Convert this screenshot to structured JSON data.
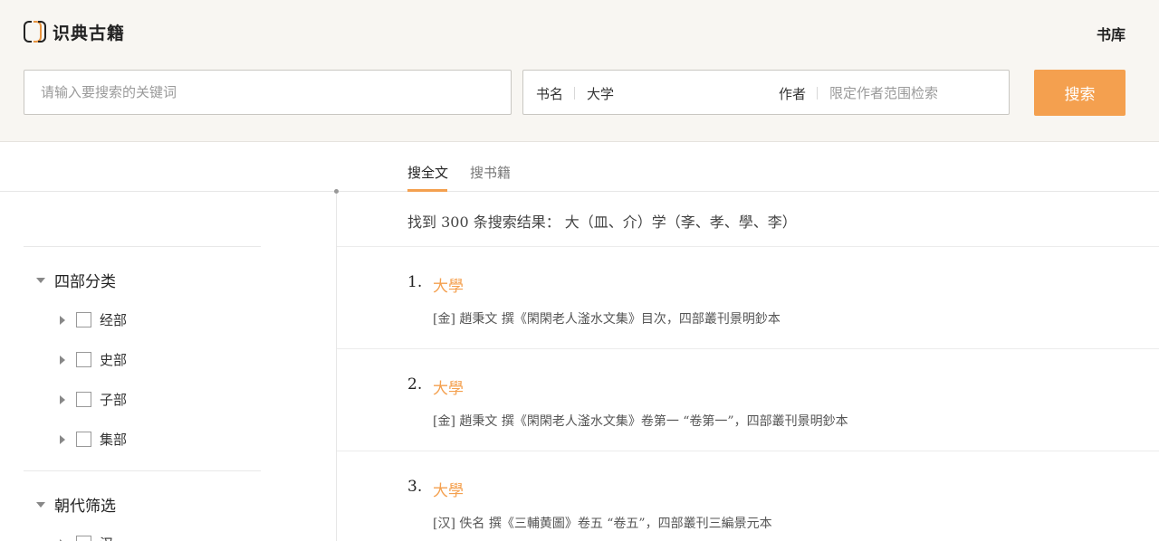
{
  "header": {
    "logo_text": "识典古籍",
    "library_link": "书库"
  },
  "search": {
    "keyword_placeholder": "请输入要搜索的关键词",
    "book_label": "书名",
    "book_value": "大学",
    "author_label": "作者",
    "author_placeholder": "限定作者范围检索",
    "button_label": "搜索"
  },
  "tabs": [
    {
      "label": "搜全文",
      "active": true
    },
    {
      "label": "搜书籍",
      "active": false
    }
  ],
  "sidebar": {
    "groups": [
      {
        "title": "四部分类",
        "items": [
          "经部",
          "史部",
          "子部",
          "集部"
        ]
      },
      {
        "title": "朝代筛选",
        "items": [
          "汉"
        ]
      }
    ]
  },
  "results": {
    "summary": "找到 300 条搜索结果： 大（皿、介）学（斈、孝、學、李）",
    "items": [
      {
        "num": "1.",
        "title": "大學",
        "meta": "[金] 趙秉文 撰《閑閑老人滏水文集》目次，四部叢刊景明鈔本"
      },
      {
        "num": "2.",
        "title": "大學",
        "meta": "[金] 趙秉文 撰《閑閑老人滏水文集》卷第一 “卷第一”，四部叢刊景明鈔本"
      },
      {
        "num": "3.",
        "title": "大學",
        "meta": "[汉] 佚名 撰《三輔黄圖》卷五 “卷五”，四部叢刊三編景元本"
      }
    ]
  },
  "colors": {
    "accent": "#f4a04f",
    "header_bg": "#f8f6f2"
  }
}
